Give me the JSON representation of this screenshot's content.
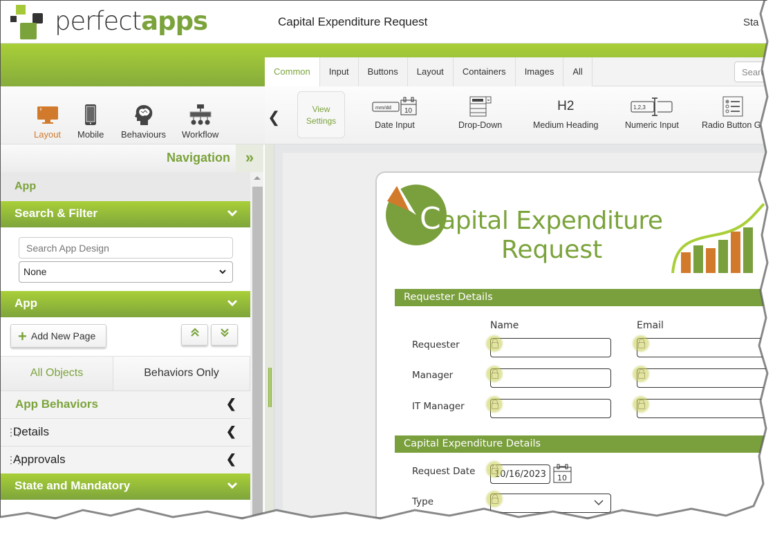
{
  "header": {
    "logo_text_plain": "perfect",
    "logo_text_bold": "apps",
    "app_title": "Capital Expenditure Request",
    "status_text": "Sta"
  },
  "modes": [
    {
      "label": "Layout",
      "icon": "desktop-monitor-icon",
      "active": true
    },
    {
      "label": "Mobile",
      "icon": "mobile-phone-icon",
      "active": false
    },
    {
      "label": "Behaviours",
      "icon": "brain-head-icon",
      "active": false
    },
    {
      "label": "Workflow",
      "icon": "workflow-hierarchy-icon",
      "active": false
    }
  ],
  "ribbon": {
    "tabs": [
      {
        "label": "Common",
        "active": true
      },
      {
        "label": "Input"
      },
      {
        "label": "Buttons"
      },
      {
        "label": "Layout"
      },
      {
        "label": "Containers"
      },
      {
        "label": "Images"
      },
      {
        "label": "All"
      }
    ],
    "search_placeholder": "Search",
    "view_settings_line1": "View",
    "view_settings_line2": "Settings",
    "tools": [
      {
        "label": "Date Input",
        "icon": "date-input-icon",
        "icon_text_top": "mm/dd",
        "icon_text_day": "10"
      },
      {
        "label": "Drop-Down",
        "icon": "dropdown-icon"
      },
      {
        "label": "Medium Heading",
        "icon": "h2-heading-icon",
        "icon_text": "H2"
      },
      {
        "label": "Numeric Input",
        "icon": "numeric-input-icon",
        "icon_text": "1,2,3"
      },
      {
        "label": "Radio Button Gr",
        "icon": "radio-group-icon"
      }
    ]
  },
  "nav": {
    "title": "Navigation",
    "app_label": "App",
    "search_filter": {
      "header": "Search & Filter",
      "search_placeholder": "Search App Design",
      "filter_value": "None"
    },
    "app_section": {
      "header": "App",
      "add_page_label": "Add New Page"
    },
    "object_tabs": [
      {
        "label": "All Objects",
        "active": true
      },
      {
        "label": "Behaviors Only",
        "active": false
      }
    ],
    "tree": [
      {
        "label": "App Behaviors",
        "style": "green"
      },
      {
        "label": "Details",
        "style": "page"
      },
      {
        "label": "Approvals",
        "style": "page"
      }
    ],
    "state_section": {
      "header": "State and Mandatory"
    }
  },
  "form": {
    "banner_title_line1_initial": "C",
    "banner_title_line1_rest": "apital Expenditure",
    "banner_title_line2": "Request",
    "colors": {
      "primary": "#7a9f3d",
      "accent": "#d27a2c",
      "lime": "#a9cf38"
    },
    "requester_section": {
      "title": "Requester Details",
      "columns": [
        "Name",
        "Email"
      ],
      "rows": [
        {
          "label": "Requester",
          "name": "",
          "email": ""
        },
        {
          "label": "Manager",
          "name": "",
          "email": ""
        },
        {
          "label": "IT Manager",
          "name": "",
          "email": ""
        }
      ]
    },
    "capex_section": {
      "title": "Capital Expenditure Details",
      "request_date_label": "Request Date",
      "request_date_value": "10/16/2023",
      "calendar_day": "10",
      "type_label": "Type",
      "type_value": ""
    }
  }
}
